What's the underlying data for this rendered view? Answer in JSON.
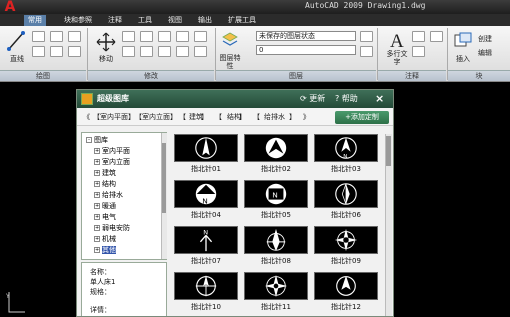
{
  "window": {
    "title": "AutoCAD 2009  Drawing1.dwg"
  },
  "tabs": [
    {
      "label": "常用",
      "active": true
    },
    {
      "label": "块和参照"
    },
    {
      "label": "注释"
    },
    {
      "label": "工具"
    },
    {
      "label": "视图"
    },
    {
      "label": "输出"
    },
    {
      "label": "扩展工具"
    }
  ],
  "ribbon": {
    "panels": {
      "draw": "绘图",
      "modify": "修改",
      "layers": "图层",
      "annotation": "注释",
      "block": "块"
    },
    "line_label": "直线",
    "move_label": "移动",
    "layer_props_label": "图层特性",
    "layer_state": "未保存的图层状态",
    "layer_current": "0",
    "mtext_label": "多行文字",
    "insert_label": "插入",
    "create_label": "创建",
    "edit_label": "编辑"
  },
  "dialog": {
    "title": "超级图库",
    "refresh": "更新",
    "help": "帮助",
    "close": "×",
    "breadcrumb": [
      "《",
      "【室内平面】",
      "【室内立面】",
      "【",
      "建筑",
      "】",
      "【",
      "结构",
      "】",
      "【",
      "给排水",
      "】",
      "》"
    ],
    "add_custom": "+添加定制",
    "tree": [
      {
        "label": "图库",
        "sign": "-",
        "indent": 0
      },
      {
        "label": "室内平面",
        "sign": "+",
        "indent": 1
      },
      {
        "label": "室内立面",
        "sign": "+",
        "indent": 1
      },
      {
        "label": "建筑",
        "sign": "+",
        "indent": 1
      },
      {
        "label": "结构",
        "sign": "+",
        "indent": 1
      },
      {
        "label": "给排水",
        "sign": "+",
        "indent": 1
      },
      {
        "label": "暖通",
        "sign": "+",
        "indent": 1
      },
      {
        "label": "电气",
        "sign": "+",
        "indent": 1
      },
      {
        "label": "弱电安防",
        "sign": "+",
        "indent": 1
      },
      {
        "label": "机械",
        "sign": "+",
        "indent": 1
      },
      {
        "label": "其他",
        "sign": "+",
        "indent": 1,
        "selected": true
      }
    ],
    "info": {
      "name_label": "名称：",
      "author": "单人床1",
      "spec_label": "规格：",
      "detail_label": "详情："
    },
    "items": [
      "指北针01",
      "指北针02",
      "指北针03",
      "指北针04",
      "指北针05",
      "指北针06",
      "指北针07",
      "指北针08",
      "指北针09",
      "指北针10",
      "指北针11",
      "指北针12"
    ]
  },
  "colors": {
    "dialog_title": "#2f5a44",
    "add_button": "#3a8a5c",
    "tab_active": "#5a7fa8"
  }
}
